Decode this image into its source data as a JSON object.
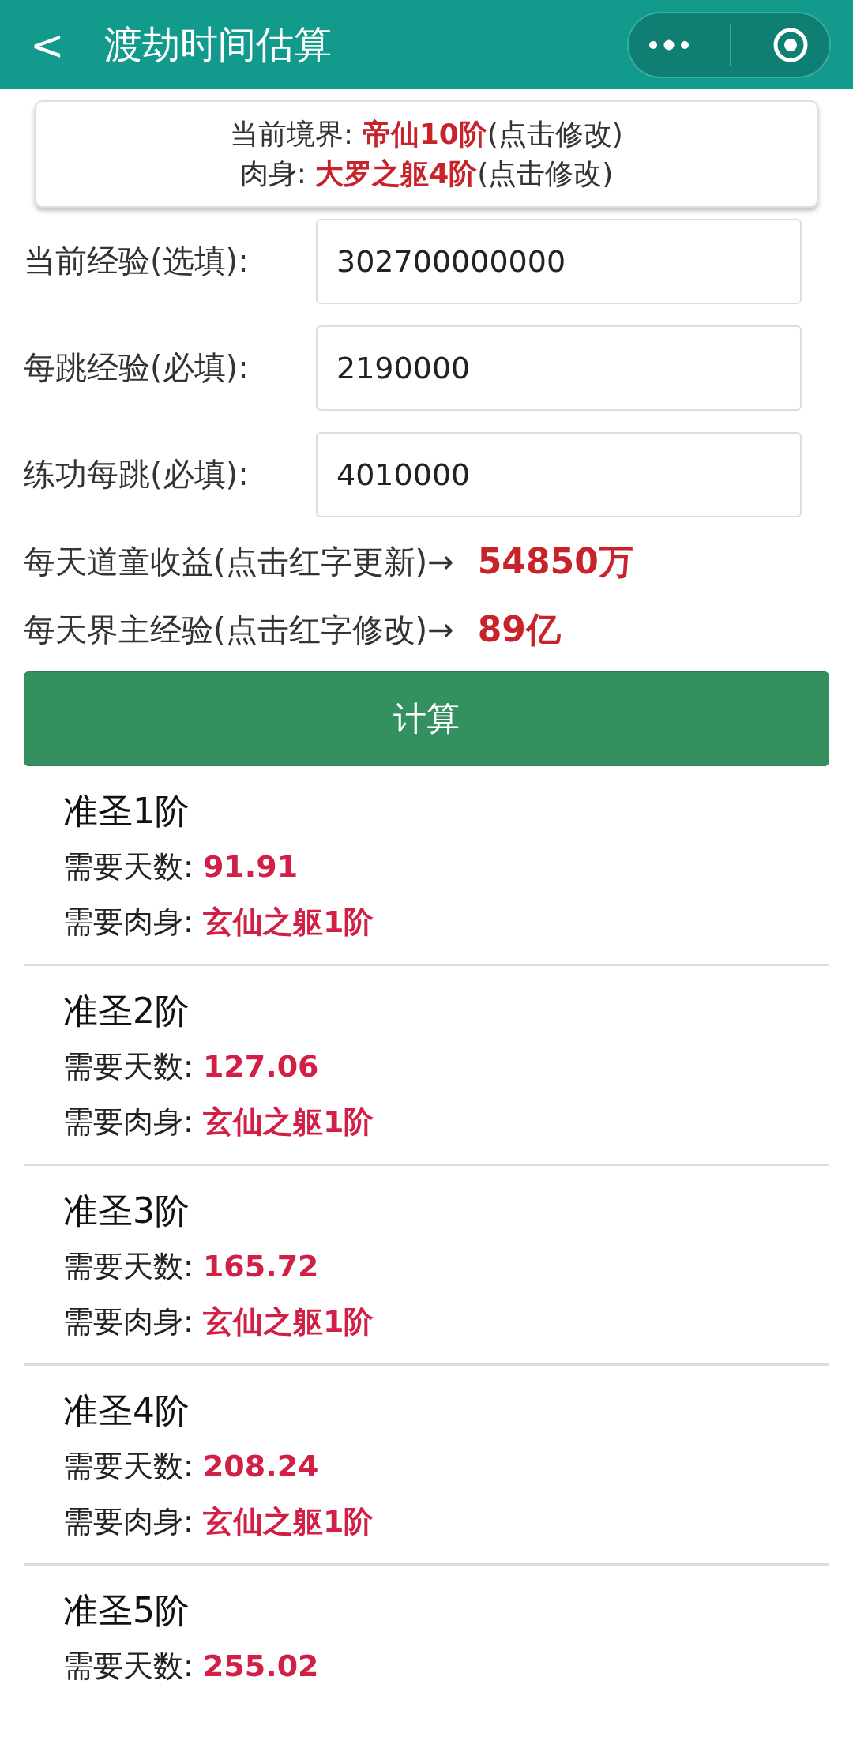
{
  "header": {
    "back": "<",
    "title": "渡劫时间估算"
  },
  "realm_card": {
    "lines": [
      {
        "label": "当前境界:",
        "value": "帝仙10阶",
        "hint": "(点击修改)"
      },
      {
        "label": "肉身:",
        "value": "大罗之躯4阶",
        "hint": "(点击修改)"
      }
    ]
  },
  "fields": [
    {
      "label": "当前经验(选填):",
      "value": "302700000000"
    },
    {
      "label": "每跳经验(必填):",
      "value": "2190000"
    },
    {
      "label": "练功每跳(必填):",
      "value": "4010000"
    }
  ],
  "daily": [
    {
      "label": "每天道童收益(点击红字更新)→",
      "value": "54850万"
    },
    {
      "label": "每天界主经验(点击红字修改)→",
      "value": "89亿"
    }
  ],
  "calculate_button": "计算",
  "results": [
    {
      "title": "准圣1阶",
      "days_label": "需要天数:",
      "days": "91.91",
      "body_label": "需要肉身:",
      "body": "玄仙之躯1阶"
    },
    {
      "title": "准圣2阶",
      "days_label": "需要天数:",
      "days": "127.06",
      "body_label": "需要肉身:",
      "body": "玄仙之躯1阶"
    },
    {
      "title": "准圣3阶",
      "days_label": "需要天数:",
      "days": "165.72",
      "body_label": "需要肉身:",
      "body": "玄仙之躯1阶"
    },
    {
      "title": "准圣4阶",
      "days_label": "需要天数:",
      "days": "208.24",
      "body_label": "需要肉身:",
      "body": "玄仙之躯1阶"
    },
    {
      "title": "准圣5阶",
      "days_label": "需要天数:",
      "days": "255.02"
    }
  ]
}
